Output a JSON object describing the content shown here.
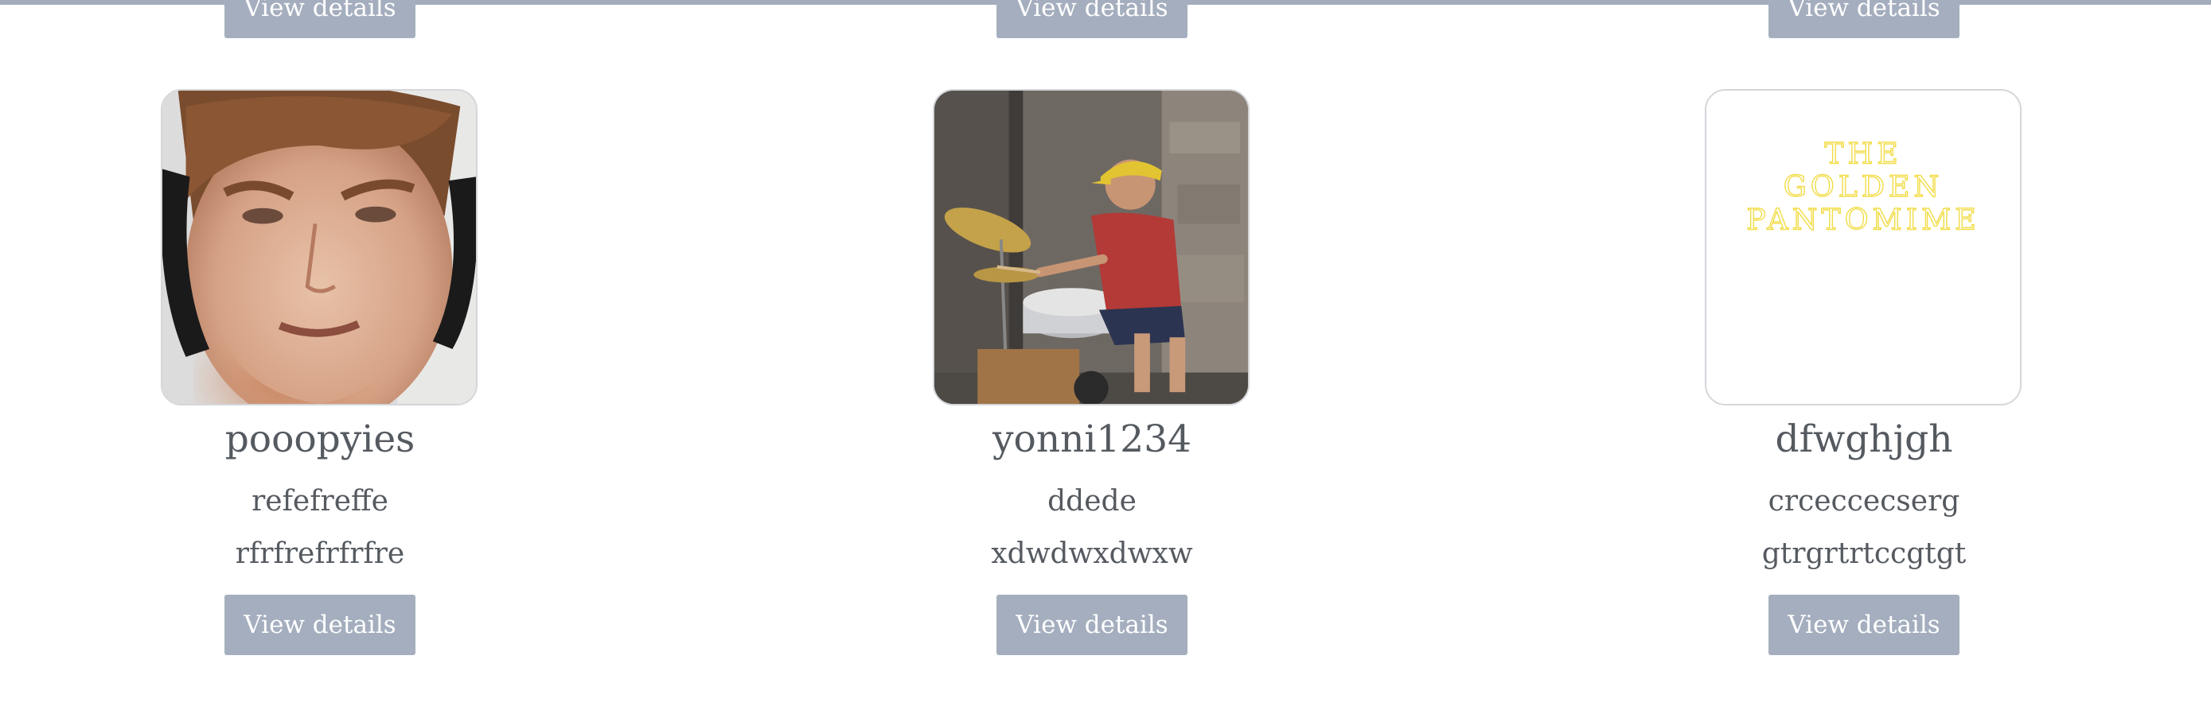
{
  "profiles": [
    {
      "username": "pooopyies",
      "line1": "refefreffe",
      "line2": "rfrfrefrfrfre",
      "button_label": "View details",
      "avatar": "photo-person-headphones"
    },
    {
      "username": "yonni1234",
      "line1": "ddede",
      "line2": "xdwdwxdwxw",
      "button_label": "View details",
      "avatar": "photo-drummer"
    },
    {
      "username": "dfwghjgh",
      "line1": "crceccecserg",
      "line2": "gtrgrtrtccgtgt",
      "button_label": "View details",
      "avatar": "logo-text",
      "avatar_text": [
        "THE",
        "GOLDEN",
        "PANTOMIME"
      ]
    }
  ],
  "previous_row_buttons": [
    "View details",
    "View details",
    "View details"
  ],
  "colors": {
    "button_bg": "#a4aebe",
    "text": "#555a60",
    "logo_text": "#f2dc45"
  }
}
